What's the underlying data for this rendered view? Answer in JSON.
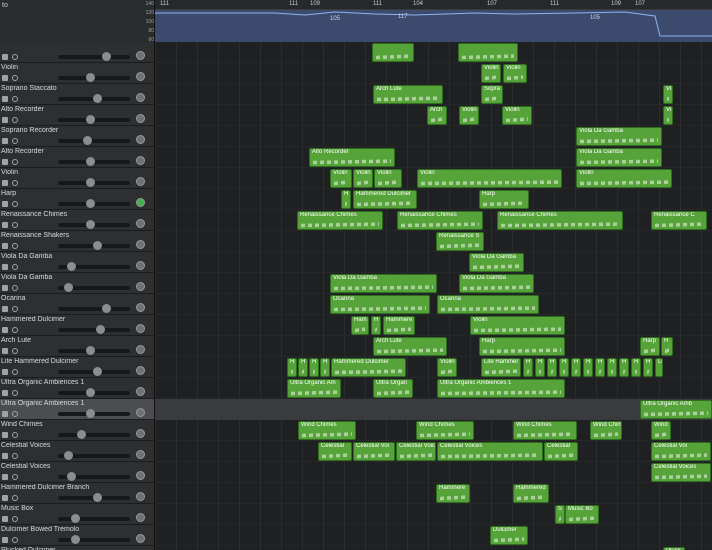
{
  "header": {
    "title": "to",
    "ruler_marks": [
      "111",
      "111",
      "109",
      "111",
      "104",
      "107",
      "111",
      "109",
      "107"
    ],
    "tempo_labels": [
      "105",
      "117",
      "105"
    ],
    "tempo_scale": [
      "140",
      "120",
      "100",
      "80",
      "60"
    ]
  },
  "tracks": [
    {
      "name": "",
      "selected": false
    },
    {
      "name": "Violin",
      "selected": false
    },
    {
      "name": "Soprano Staccato",
      "selected": false
    },
    {
      "name": "Alto Recorder",
      "selected": false
    },
    {
      "name": "Soprano Recorder",
      "selected": false
    },
    {
      "name": "Alto Recorder",
      "selected": false
    },
    {
      "name": "Violin",
      "selected": false
    },
    {
      "name": "Harp",
      "selected": false
    },
    {
      "name": "Renaissance Chimes",
      "selected": false
    },
    {
      "name": "Renaissance Shakers",
      "selected": false
    },
    {
      "name": "Viola Da Gamba",
      "selected": false
    },
    {
      "name": "Viola Da Gamba",
      "selected": false
    },
    {
      "name": "Ocarina",
      "selected": false
    },
    {
      "name": "Hammered Dulcimer",
      "selected": false
    },
    {
      "name": "Arch Lute",
      "selected": false
    },
    {
      "name": "Lite Hammered Dulcimer",
      "selected": false
    },
    {
      "name": "Ultra Organic Ambiences 1",
      "selected": false
    },
    {
      "name": "Ultra Organic Ambiences 1",
      "selected": true
    },
    {
      "name": "Wind Chimes",
      "selected": false
    },
    {
      "name": "Celestial Voices",
      "selected": false
    },
    {
      "name": "Celestial Voices",
      "selected": false
    },
    {
      "name": "Hammered Dulcimer Branch",
      "selected": false
    },
    {
      "name": "Music Box",
      "selected": false
    },
    {
      "name": "Dulcimer Bowed Tremolo",
      "selected": false
    },
    {
      "name": "Plucked Dulcimer",
      "selected": false
    }
  ],
  "regions": [
    {
      "row": 0,
      "start": 217,
      "len": 42,
      "name": ""
    },
    {
      "row": 0,
      "start": 303,
      "len": 60,
      "name": ""
    },
    {
      "row": 1,
      "start": 326,
      "len": 20,
      "name": "Violin"
    },
    {
      "row": 1,
      "start": 348,
      "len": 24,
      "name": "Violin"
    },
    {
      "row": 2,
      "start": 218,
      "len": 70,
      "name": "Arch Lute"
    },
    {
      "row": 2,
      "start": 326,
      "len": 22,
      "name": "Sopra"
    },
    {
      "row": 2,
      "start": 508,
      "len": 10,
      "name": "Vi"
    },
    {
      "row": 3,
      "start": 272,
      "len": 20,
      "name": "Arch"
    },
    {
      "row": 3,
      "start": 304,
      "len": 20,
      "name": "Violin"
    },
    {
      "row": 3,
      "start": 347,
      "len": 30,
      "name": "Violin"
    },
    {
      "row": 3,
      "start": 508,
      "len": 10,
      "name": "Vi"
    },
    {
      "row": 4,
      "start": 421,
      "len": 86,
      "name": "Viola Da Gamba"
    },
    {
      "row": 5,
      "start": 154,
      "len": 86,
      "name": "Alto Recorder"
    },
    {
      "row": 5,
      "start": 421,
      "len": 86,
      "name": "Viola Da Gamba"
    },
    {
      "row": 6,
      "start": 175,
      "len": 22,
      "name": "Violin"
    },
    {
      "row": 6,
      "start": 198,
      "len": 20,
      "name": "Violin"
    },
    {
      "row": 6,
      "start": 219,
      "len": 28,
      "name": "Violin"
    },
    {
      "row": 6,
      "start": 262,
      "len": 145,
      "name": "Violin"
    },
    {
      "row": 6,
      "start": 421,
      "len": 96,
      "name": "Violin"
    },
    {
      "row": 7,
      "start": 186,
      "len": 10,
      "name": "H"
    },
    {
      "row": 7,
      "start": 198,
      "len": 64,
      "name": "Hammered Dulcimer"
    },
    {
      "row": 7,
      "start": 324,
      "len": 50,
      "name": "Harp"
    },
    {
      "row": 8,
      "start": 142,
      "len": 86,
      "name": "Renaissance Chimes"
    },
    {
      "row": 8,
      "start": 242,
      "len": 86,
      "name": "Renaissance Chimes"
    },
    {
      "row": 8,
      "start": 342,
      "len": 126,
      "name": "Renaissance Chimes"
    },
    {
      "row": 8,
      "start": 496,
      "len": 56,
      "name": "Renaissance C"
    },
    {
      "row": 9,
      "start": 281,
      "len": 48,
      "name": "Renaissance S"
    },
    {
      "row": 10,
      "start": 314,
      "len": 55,
      "name": "Viola Da Gamba"
    },
    {
      "row": 11,
      "start": 175,
      "len": 107,
      "name": "Viola Da Gamba"
    },
    {
      "row": 11,
      "start": 304,
      "len": 75,
      "name": "Viola Da Gamba"
    },
    {
      "row": 12,
      "start": 175,
      "len": 100,
      "name": "Ocarina"
    },
    {
      "row": 12,
      "start": 282,
      "len": 102,
      "name": "Ocarina"
    },
    {
      "row": 13,
      "start": 196,
      "len": 18,
      "name": "Ham"
    },
    {
      "row": 13,
      "start": 216,
      "len": 10,
      "name": "H"
    },
    {
      "row": 13,
      "start": 228,
      "len": 32,
      "name": "Hammere"
    },
    {
      "row": 13,
      "start": 315,
      "len": 95,
      "name": "Violin"
    },
    {
      "row": 14,
      "start": 218,
      "len": 74,
      "name": "Arch Lute"
    },
    {
      "row": 14,
      "start": 324,
      "len": 86,
      "name": "Harp"
    },
    {
      "row": 14,
      "start": 485,
      "len": 20,
      "name": "Harp"
    },
    {
      "row": 14,
      "start": 506,
      "len": 12,
      "name": "H"
    },
    {
      "row": 15,
      "start": 132,
      "len": 10,
      "name": "H"
    },
    {
      "row": 15,
      "start": 143,
      "len": 10,
      "name": "H"
    },
    {
      "row": 15,
      "start": 154,
      "len": 10,
      "name": "H"
    },
    {
      "row": 15,
      "start": 165,
      "len": 10,
      "name": "H"
    },
    {
      "row": 15,
      "start": 176,
      "len": 75,
      "name": "Hammered Dulcimer"
    },
    {
      "row": 15,
      "start": 282,
      "len": 20,
      "name": "Violin"
    },
    {
      "row": 15,
      "start": 326,
      "len": 40,
      "name": "Lite Hammer"
    },
    {
      "row": 15,
      "start": 368,
      "len": 10,
      "name": "H"
    },
    {
      "row": 15,
      "start": 380,
      "len": 10,
      "name": "H"
    },
    {
      "row": 15,
      "start": 392,
      "len": 10,
      "name": "H"
    },
    {
      "row": 15,
      "start": 404,
      "len": 10,
      "name": "H"
    },
    {
      "row": 15,
      "start": 416,
      "len": 10,
      "name": "H"
    },
    {
      "row": 15,
      "start": 428,
      "len": 10,
      "name": "H"
    },
    {
      "row": 15,
      "start": 440,
      "len": 10,
      "name": "H"
    },
    {
      "row": 15,
      "start": 452,
      "len": 10,
      "name": "H"
    },
    {
      "row": 15,
      "start": 464,
      "len": 10,
      "name": "H"
    },
    {
      "row": 15,
      "start": 476,
      "len": 10,
      "name": "H"
    },
    {
      "row": 15,
      "start": 488,
      "len": 10,
      "name": "H"
    },
    {
      "row": 15,
      "start": 500,
      "len": 8,
      "name": "Lit"
    },
    {
      "row": 16,
      "start": 132,
      "len": 54,
      "name": "Ultra Organic Am"
    },
    {
      "row": 16,
      "start": 218,
      "len": 40,
      "name": "Ultra Organ"
    },
    {
      "row": 16,
      "start": 282,
      "len": 128,
      "name": "Ultra Organic Ambiences 1"
    },
    {
      "row": 17,
      "start": 485,
      "len": 80,
      "name": "Ultra Organic Amb"
    },
    {
      "row": 18,
      "start": 143,
      "len": 58,
      "name": "Wind Chimes"
    },
    {
      "row": 18,
      "start": 261,
      "len": 58,
      "name": "Wind Chimes"
    },
    {
      "row": 18,
      "start": 358,
      "len": 64,
      "name": "Wind Chimes"
    },
    {
      "row": 18,
      "start": 435,
      "len": 32,
      "name": "Wind Chim"
    },
    {
      "row": 18,
      "start": 496,
      "len": 20,
      "name": "Wind"
    },
    {
      "row": 19,
      "start": 163,
      "len": 34,
      "name": "Celestial"
    },
    {
      "row": 19,
      "start": 198,
      "len": 42,
      "name": "Celestial Voi"
    },
    {
      "row": 19,
      "start": 241,
      "len": 40,
      "name": "Celestial Voic"
    },
    {
      "row": 19,
      "start": 282,
      "len": 106,
      "name": "Celestial Voices"
    },
    {
      "row": 19,
      "start": 389,
      "len": 34,
      "name": "Celestial"
    },
    {
      "row": 19,
      "start": 496,
      "len": 60,
      "name": "Celestial Voi"
    },
    {
      "row": 20,
      "start": 496,
      "len": 60,
      "name": "Celestial Voices"
    },
    {
      "row": 21,
      "start": 281,
      "len": 34,
      "name": "Hammere"
    },
    {
      "row": 21,
      "start": 358,
      "len": 36,
      "name": "Hammered"
    },
    {
      "row": 22,
      "start": 400,
      "len": 10,
      "name": "S"
    },
    {
      "row": 22,
      "start": 410,
      "len": 34,
      "name": "Music Bo"
    },
    {
      "row": 23,
      "start": 335,
      "len": 38,
      "name": "Dulcimer"
    },
    {
      "row": 24,
      "start": 508,
      "len": 22,
      "name": "Pluck"
    }
  ],
  "slider_levels": [
    0.7,
    0.45,
    0.55,
    0.45,
    0.4,
    0.45,
    0.45,
    0.45,
    0.45,
    0.55,
    0.15,
    0.1,
    0.7,
    0.6,
    0.45,
    0.55,
    0.45,
    0.45,
    0.3,
    0.1,
    0.15,
    0.55,
    0.2,
    0.2,
    0.45
  ],
  "colors": {
    "region": "#56a33a",
    "tempo_bg": "#3c4b6d",
    "selected_row": "#4c4d50"
  }
}
